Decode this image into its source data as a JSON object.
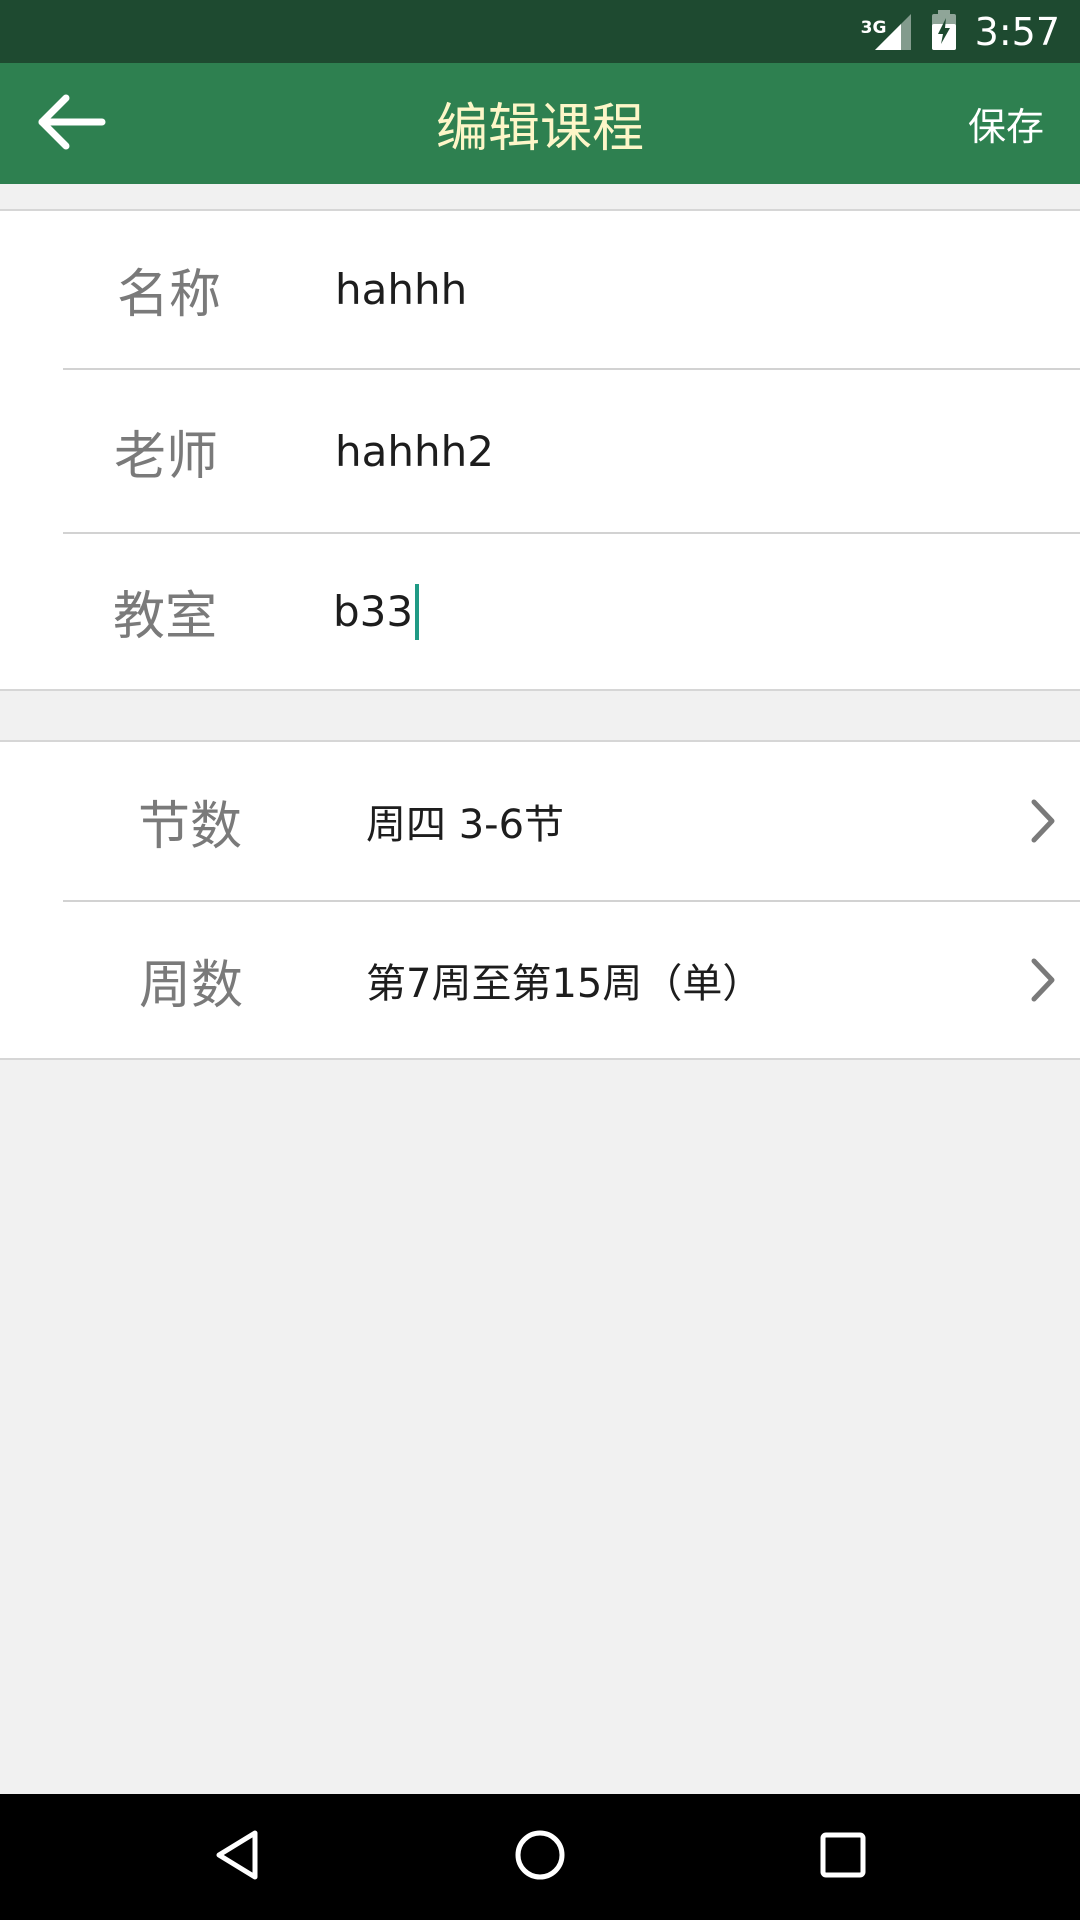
{
  "status_bar": {
    "network_type": "3G",
    "time": "3:57",
    "icons": [
      "signal-icon",
      "battery-charging-icon"
    ]
  },
  "app_bar": {
    "back_icon": "arrow-left-icon",
    "title": "编辑课程",
    "save_label": "保存"
  },
  "form": {
    "name": {
      "label": "名称",
      "value": "hahhh"
    },
    "teacher": {
      "label": "老师",
      "value": "hahhh2"
    },
    "classroom": {
      "label": "教室",
      "value": "b33"
    }
  },
  "schedule": {
    "sections": {
      "label": "节数",
      "value": "周四 3-6节",
      "icon": "chevron-right-icon"
    },
    "weeks": {
      "label": "周数",
      "value": "第7周至第15周（单）",
      "icon": "chevron-right-icon"
    }
  },
  "nav": {
    "icons": [
      "nav-back-icon",
      "nav-home-icon",
      "nav-recents-icon"
    ]
  },
  "colors": {
    "status_bar": "#1e4a30",
    "app_bar": "#2e8050",
    "title_text": "#fdf6c8",
    "cursor": "#1f9a85",
    "background": "#f1f1f1"
  }
}
